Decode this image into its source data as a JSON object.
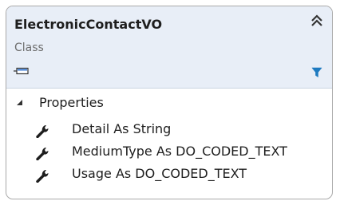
{
  "class_box": {
    "name": "ElectronicContactVO",
    "kind": "Class",
    "icons": {
      "collapse": "double-chevron-up-icon",
      "type": "class-shortcut-icon",
      "filter": "filter-funnel-icon"
    },
    "colors": {
      "header_background": "#e8eef7",
      "border": "#a9a9a9",
      "filter_icon": "#1f7bc0"
    }
  },
  "sections": [
    {
      "title": "Properties",
      "expanded": true,
      "members": [
        {
          "label": "Detail As String",
          "icon": "wrench-icon"
        },
        {
          "label": "MediumType As DO_CODED_TEXT",
          "icon": "wrench-icon"
        },
        {
          "label": "Usage As DO_CODED_TEXT",
          "icon": "wrench-icon"
        }
      ]
    }
  ]
}
